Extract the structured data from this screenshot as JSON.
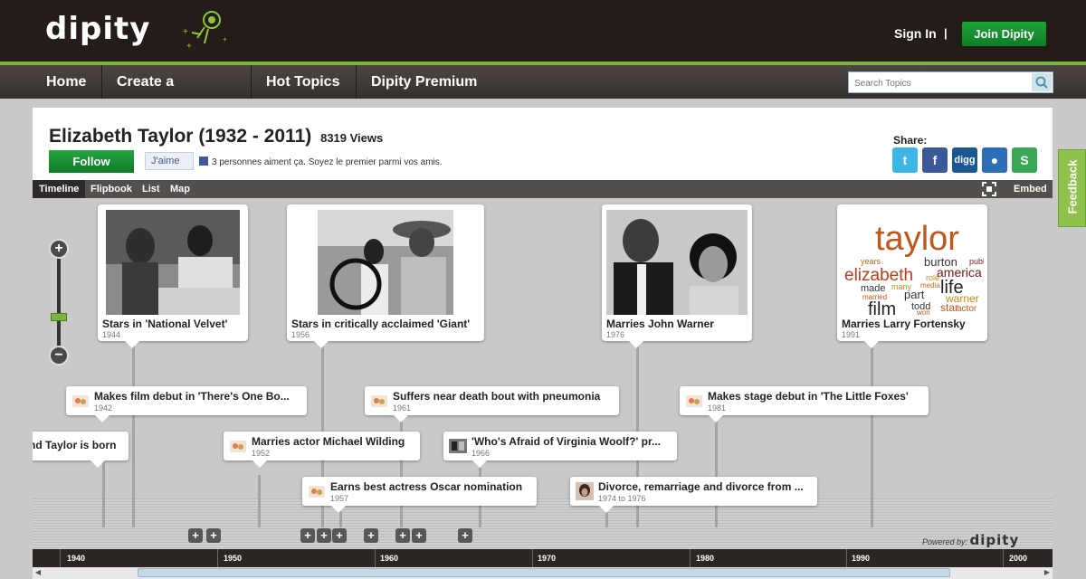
{
  "header": {
    "logo": "dipity",
    "sign_in": "Sign In",
    "separator": "|",
    "join": "Join Dipity"
  },
  "nav": {
    "items": [
      "Home",
      "Create a Timeline",
      "Hot Topics",
      "Dipity Premium"
    ],
    "search_placeholder": "Search Topics"
  },
  "timeline": {
    "title": "Elizabeth Taylor (1932 - 2011)",
    "views": "8319 Views",
    "follow": "Follow",
    "like": "J'aime",
    "like_text": "3 personnes aiment ça. Soyez le premier parmi vos amis.",
    "share_label": "Share:",
    "share_icons": [
      "twitter-icon",
      "facebook-icon",
      "digg-icon",
      "myspace-icon",
      "stumbleupon-icon"
    ]
  },
  "feedback": "Feedback",
  "tabs": [
    "Timeline",
    "Flipbook",
    "List",
    "Map"
  ],
  "embed": "Embed",
  "events_big": [
    {
      "title": "Stars in 'National Velvet'",
      "year": "1944"
    },
    {
      "title": "Stars in critically acclaimed 'Giant'",
      "year": "1956"
    },
    {
      "title": "Marries John Warner",
      "year": "1976"
    },
    {
      "title": "Marries Larry Fortensky",
      "year": "1991"
    }
  ],
  "events_small": [
    {
      "title": "Makes film debut in 'There's One Bo...",
      "year": "1942"
    },
    {
      "title": "Suffers near death bout with pneumonia",
      "year": "1961"
    },
    {
      "title": "Makes stage debut in 'The Little Foxes'",
      "year": "1981"
    },
    {
      "title": "nd Taylor is born",
      "year": ""
    },
    {
      "title": "Marries actor Michael Wilding",
      "year": "1952"
    },
    {
      "title": "'Who's Afraid of Virginia Woolf?' pr...",
      "year": "1966"
    },
    {
      "title": "Earns best actress Oscar nomination",
      "year": "1957"
    },
    {
      "title": "Divorce, remarriage and divorce from ...",
      "year": "1974 to 1976"
    }
  ],
  "wordcloud": [
    "taylor",
    "years",
    "burton",
    "america",
    "elizabeth",
    "role",
    "life",
    "made",
    "many",
    "media",
    "married",
    "part",
    "todd",
    "warner",
    "star",
    "actor",
    "film",
    "won",
    "publ"
  ],
  "zoom": {
    "plus": "+",
    "minus": "−"
  },
  "more_buttons": "+",
  "powered_by": "Powered by:",
  "powered_logo": "dipity",
  "axis_years": [
    "1940",
    "1950",
    "1960",
    "1970",
    "1980",
    "1990",
    "2000"
  ],
  "colors": {
    "brand_green": "#7cb342",
    "header_bg": "#231c19",
    "twitter": "#3fb5e6",
    "facebook": "#3b5998",
    "digg": "#1b5891",
    "myspace": "#2d6fb6",
    "stumbleupon": "#3aa757"
  }
}
